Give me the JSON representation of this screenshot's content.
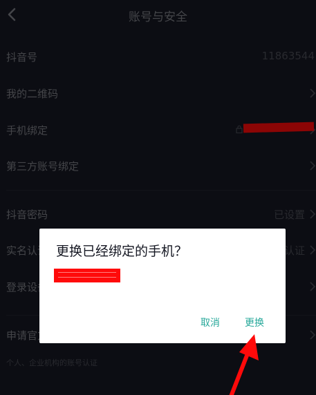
{
  "header": {
    "title": "账号与安全"
  },
  "rows": [
    {
      "label": "抖音号",
      "value": "11863544"
    },
    {
      "label": "我的二维码",
      "value": ""
    },
    {
      "label": "手机绑定",
      "value": ""
    },
    {
      "label": "第三方账号绑定",
      "value": ""
    },
    {
      "label": "抖音密码",
      "value": "已设置"
    },
    {
      "label": "实名认证",
      "value": "认证"
    },
    {
      "label": "登录设备管理",
      "value": ""
    },
    {
      "label": "申请官方认证",
      "value": ""
    }
  ],
  "sub_note": "个人、企业机构的账号认证",
  "dialog": {
    "title": "更换已经绑定的手机？",
    "cancel_label": "取消",
    "confirm_label": "更换"
  },
  "colors": {
    "background": "#161823",
    "accent": "#27a89a",
    "redaction": "#ff0a0a"
  },
  "icons": [
    "back-arrow-icon",
    "chevron-right-icon",
    "lock-icon"
  ]
}
